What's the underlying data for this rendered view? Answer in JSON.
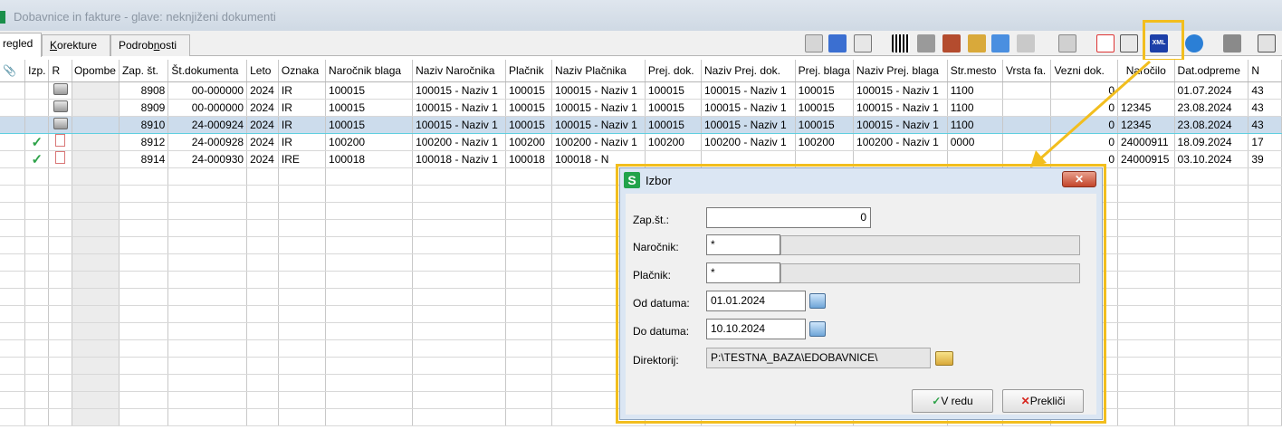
{
  "window": {
    "title": "Dobavnice in fakture - glave: neknjiženi dokumenti"
  },
  "tabs": [
    {
      "label": "regled",
      "active": true
    },
    {
      "label_pre": "",
      "label_ul": "K",
      "label_post": "orekture"
    },
    {
      "label_pre": "Podrob",
      "label_ul": "n",
      "label_post": "osti"
    }
  ],
  "grid": {
    "headers": [
      "Izp.",
      "R",
      "Opombe",
      "Zap. št.",
      "Št.dokumenta",
      "Leto",
      "Oznaka",
      "Naročnik blaga",
      "Naziv Naročnika",
      "Plačnik",
      "Naziv Plačnika",
      "Prej. dok.",
      "Naziv Prej. dok.",
      "Prej. blaga",
      "Naziv Prej. blaga",
      "Str.mesto",
      "Vrsta fa.",
      "Vezni dok.",
      "Naročilo",
      "Dat.odpreme",
      "N"
    ],
    "rows": [
      {
        "status": "printer",
        "zap": "8908",
        "stdok": "00-000000",
        "leto": "2024",
        "oznaka": "IR",
        "narocnik": "100015",
        "naziv_narocnika": "100015 - Naziv 1",
        "placnik": "100015",
        "naziv_placnika": "100015 - Naziv 1",
        "prej_dok": "100015",
        "naziv_prej_dok": "100015 - Naziv 1",
        "prej_blaga": "100015",
        "naziv_prej_blaga": "100015 - Naziv 1",
        "str_mesto": "1100",
        "vrsta": "",
        "vezni": "0",
        "narocilo": "",
        "dat_odpreme": "01.07.2024",
        "n": "43"
      },
      {
        "status": "printer",
        "zap": "8909",
        "stdok": "00-000000",
        "leto": "2024",
        "oznaka": "IR",
        "narocnik": "100015",
        "naziv_narocnika": "100015 - Naziv 1",
        "placnik": "100015",
        "naziv_placnika": "100015 - Naziv 1",
        "prej_dok": "100015",
        "naziv_prej_dok": "100015 - Naziv 1",
        "prej_blaga": "100015",
        "naziv_prej_blaga": "100015 - Naziv 1",
        "str_mesto": "1100",
        "vrsta": "",
        "vezni": "0",
        "narocilo": "12345",
        "dat_odpreme": "23.08.2024",
        "n": "43"
      },
      {
        "status": "printer",
        "selected": true,
        "zap": "8910",
        "stdok": "24-000924",
        "leto": "2024",
        "oznaka": "IR",
        "narocnik": "100015",
        "naziv_narocnika": "100015 - Naziv 1",
        "placnik": "100015",
        "naziv_placnika": "100015 - Naziv 1",
        "prej_dok": "100015",
        "naziv_prej_dok": "100015 - Naziv 1",
        "prej_blaga": "100015",
        "naziv_prej_blaga": "100015 - Naziv 1",
        "str_mesto": "1100",
        "vrsta": "",
        "vezni": "0",
        "narocilo": "12345",
        "dat_odpreme": "23.08.2024",
        "n": "43"
      },
      {
        "status": "check",
        "zap": "8912",
        "stdok": "24-000928",
        "leto": "2024",
        "oznaka": "IR",
        "narocnik": "100200",
        "naziv_narocnika": "100200 - Naziv 1",
        "placnik": "100200",
        "naziv_placnika": "100200 - Naziv 1",
        "prej_dok": "100200",
        "naziv_prej_dok": "100200 - Naziv 1",
        "prej_blaga": "100200",
        "naziv_prej_blaga": "100200 - Naziv 1",
        "str_mesto": "0000",
        "vrsta": "",
        "vezni": "0",
        "narocilo": "24000911",
        "dat_odpreme": "18.09.2024",
        "n": "17"
      },
      {
        "status": "check",
        "zap": "8914",
        "stdok": "24-000930",
        "leto": "2024",
        "oznaka": "IRE",
        "narocnik": "100018",
        "naziv_narocnika": "100018 - Naziv 1",
        "placnik": "100018",
        "naziv_placnika": "100018 - N",
        "prej_dok": "",
        "naziv_prej_dok": "",
        "prej_blaga": "",
        "naziv_prej_blaga": "",
        "str_mesto": "",
        "vrsta": "",
        "vezni": "0",
        "narocilo": "24000915",
        "dat_odpreme": "03.10.2024",
        "n": "39"
      }
    ]
  },
  "dialog": {
    "title": "Izbor",
    "logo": "S",
    "close_label": "✕",
    "zap_label": "Zap.št.:",
    "zap_value": "0",
    "narocnik_label": "Naročnik:",
    "narocnik_value": "*",
    "placnik_label": "Plačnik:",
    "placnik_value": "*",
    "od_label": "Od datuma:",
    "od_value": "01.01.2024",
    "do_label": "Do datuma:",
    "do_value": "10.10.2024",
    "dir_label": "Direktorij:",
    "dir_value": "P:\\TESTNA_BAZA\\EDOBAVNICE\\",
    "ok_label": "V redu",
    "cancel_label": "Prekliči"
  },
  "colors": {
    "highlight": "#f2be1e",
    "selected_row": "#ccdcec",
    "check": "#2fa34a"
  }
}
